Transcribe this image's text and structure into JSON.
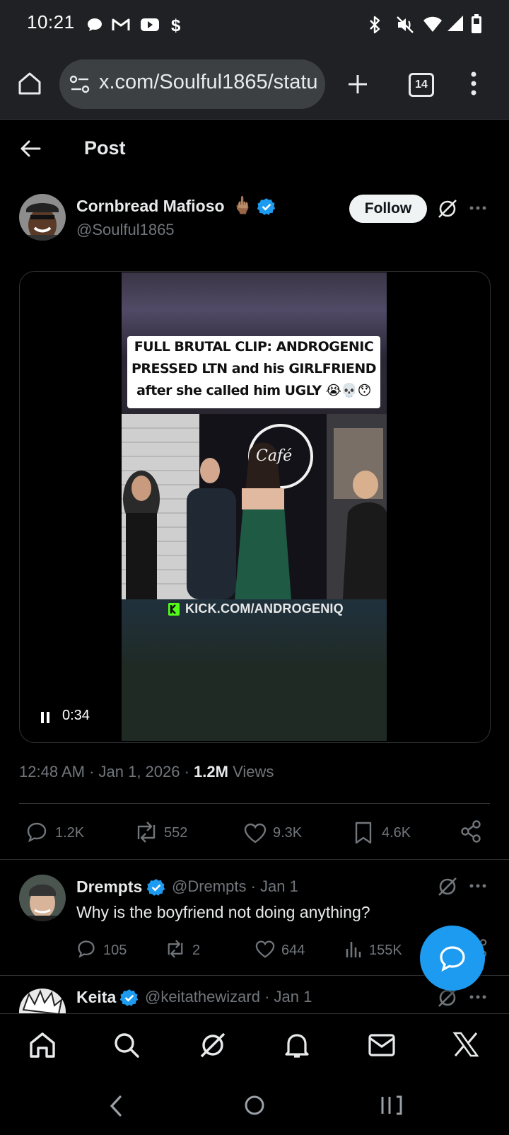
{
  "status_bar": {
    "time": "10:21"
  },
  "browser": {
    "url": "x.com/Soulful1865/status",
    "tab_count": "14"
  },
  "header": {
    "title": "Post"
  },
  "post": {
    "author_name": "Cornbread Mafioso",
    "author_emoji": "🖕🏽",
    "author_handle": "@Soulful1865",
    "follow_label": "Follow",
    "video": {
      "caption_line1": "FULL BRUTAL CLIP: ANDROGENIC",
      "caption_line2": "PRESSED LTN and his GIRLFRIEND",
      "caption_line3": "after she called him UGLY 😭💀😯",
      "watermark": "KICK.COM/ANDROGENIQ",
      "sign_text": "Café",
      "time": "0:34"
    },
    "timestamp": "12:48 AM · Jan 1, 2026 · ",
    "views_count": "1.2M",
    "views_label": " Views",
    "actions": {
      "replies": "1.2K",
      "reposts": "552",
      "likes": "9.3K",
      "bookmarks": "4.6K"
    }
  },
  "replies": [
    {
      "name": "Drempts",
      "handle": "@Drempts · Jan 1",
      "text": "Why is the boyfriend not doing anything?",
      "replies": "105",
      "reposts": "2",
      "likes": "644",
      "views": "155K"
    },
    {
      "name": "Keita",
      "handle": "@keitathewizard · Jan 1"
    }
  ],
  "colors": {
    "accent": "#1d9bf0",
    "background": "#000000",
    "muted_text": "#71767b"
  }
}
